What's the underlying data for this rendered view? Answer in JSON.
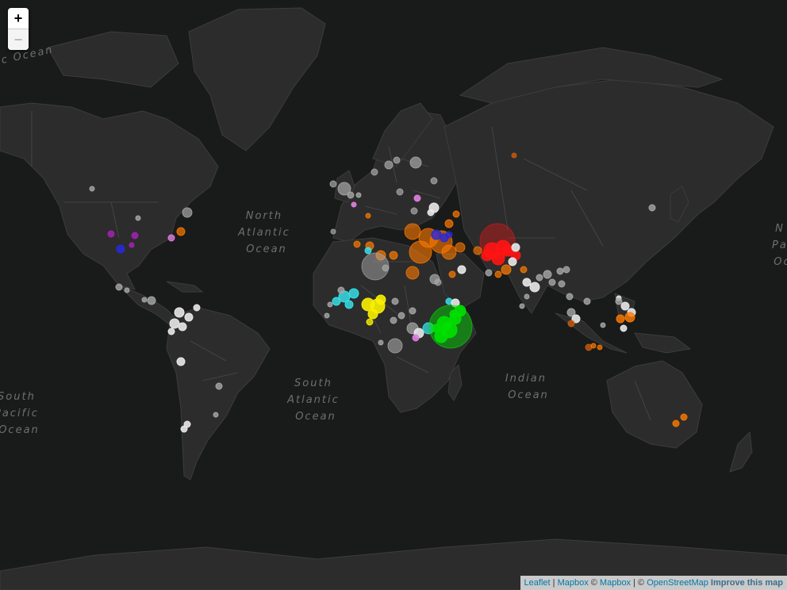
{
  "controls": {
    "zoom_in": "+",
    "zoom_out": "−"
  },
  "ocean_labels": [
    {
      "lines": [
        "North",
        "Atlantic",
        "Ocean"
      ]
    },
    {
      "lines": [
        "South",
        "Atlantic",
        "Ocean"
      ]
    },
    {
      "lines": [
        "Indian",
        "Ocean"
      ]
    },
    {
      "lines": [
        "South",
        "Pacific",
        "Ocean"
      ]
    },
    {
      "lines": [
        "N",
        "Pa",
        "Oc"
      ]
    },
    {
      "lines": [
        "ic Ocean"
      ]
    }
  ],
  "attribution": {
    "leaflet": "Leaflet",
    "sep1": " | ",
    "mapbox1": "Mapbox",
    "copy1": " © ",
    "mapbox2": "Mapbox",
    "sep2": " | © ",
    "osm": "OpenStreetMap",
    "improve": " Improve this map"
  },
  "marker_colors": {
    "white": "#e8e8e8",
    "grey": "#a8a8a8",
    "orange": "#ff7a00",
    "red": "#ff1414",
    "green": "#00e000",
    "yellow": "#f8f000",
    "cyan": "#38e8f0",
    "blue": "#2828d8",
    "purple": "#a020b0",
    "pink": "#e080e0",
    "darkorange": "#c85a10"
  }
}
